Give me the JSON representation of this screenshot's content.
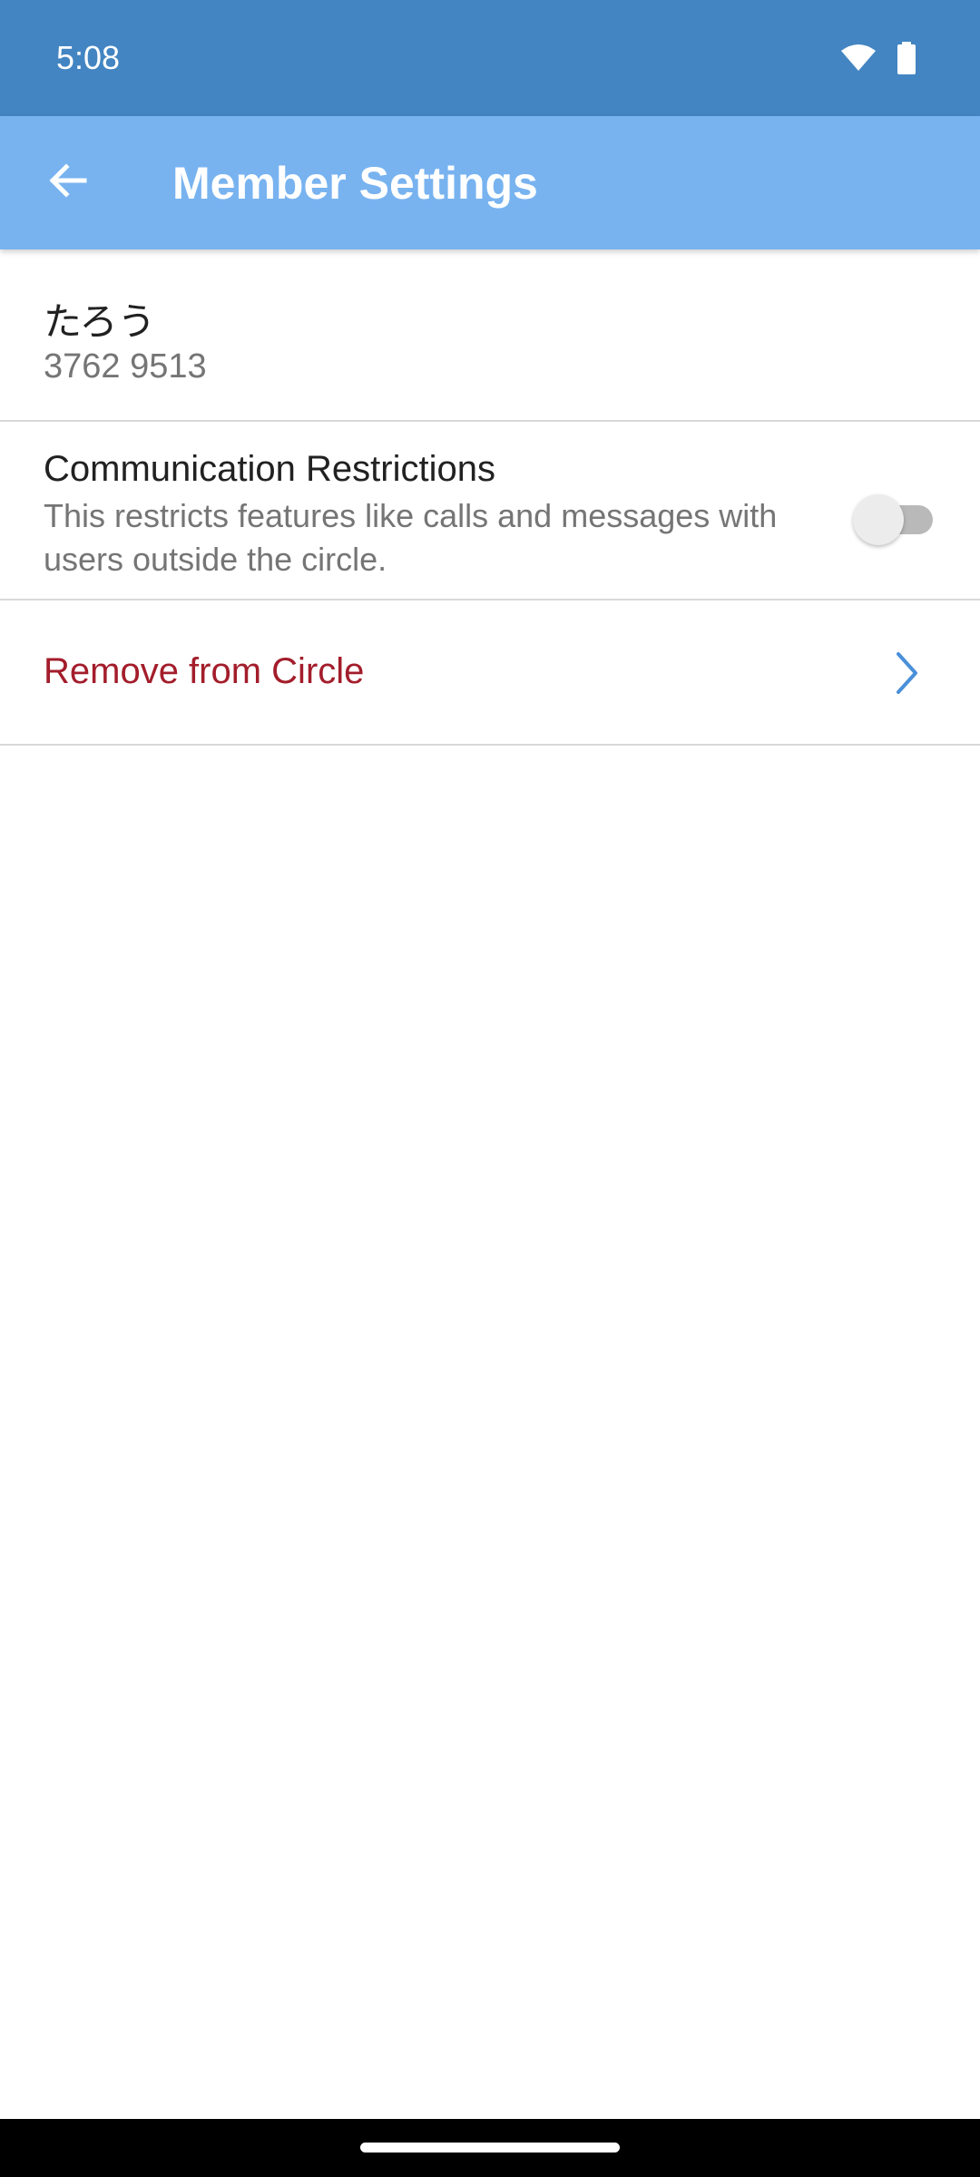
{
  "status_bar": {
    "time": "5:08",
    "icons": [
      "wifi-icon",
      "battery-icon"
    ]
  },
  "app_bar": {
    "title": "Member Settings",
    "back_icon": "arrow-left-icon"
  },
  "member": {
    "name": "たろう",
    "id": "3762 9513"
  },
  "communication_restrictions": {
    "title": "Communication Restrictions",
    "description": "This restricts features like calls and messages with users outside the circle.",
    "enabled": false
  },
  "remove": {
    "label": "Remove from Circle",
    "icon": "chevron-right-icon"
  },
  "colors": {
    "status_bar": "#4385c2",
    "app_bar": "#78b3f0",
    "danger_text": "#a31d2b",
    "chevron": "#4a90d9"
  }
}
